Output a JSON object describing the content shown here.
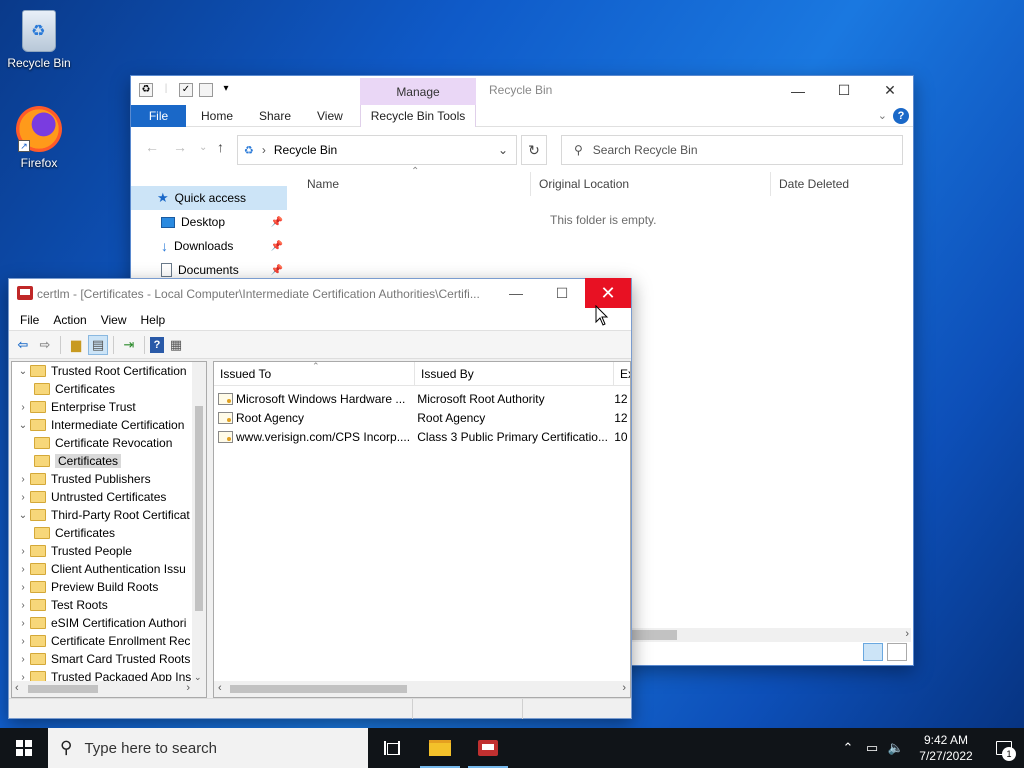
{
  "desktop": {
    "icons": [
      {
        "label": "Recycle Bin",
        "icon": "recycle-bin-icon"
      },
      {
        "label": "Firefox",
        "icon": "firefox-icon"
      }
    ]
  },
  "explorer": {
    "title": "Recycle Bin",
    "context_tab": "Manage",
    "ribbon_tabs": [
      "File",
      "Home",
      "Share",
      "View",
      "Recycle Bin Tools"
    ],
    "address": "Recycle Bin",
    "search_placeholder": "Search Recycle Bin",
    "nav": [
      {
        "label": "Quick access",
        "icon": "star-icon",
        "pinned": false
      },
      {
        "label": "Desktop",
        "icon": "desktop-icon",
        "pinned": true
      },
      {
        "label": "Downloads",
        "icon": "download-icon",
        "pinned": true
      },
      {
        "label": "Documents",
        "icon": "document-icon",
        "pinned": true
      }
    ],
    "columns": [
      "Name",
      "Original Location",
      "Date Deleted"
    ],
    "empty_message": "This folder is empty."
  },
  "certlm": {
    "title": "certlm - [Certificates - Local Computer\\Intermediate Certification Authorities\\Certifi...",
    "menu": [
      "File",
      "Action",
      "View",
      "Help"
    ],
    "tree": [
      {
        "label": "Trusted Root Certification",
        "level": 0,
        "expanded": true
      },
      {
        "label": "Certificates",
        "level": 1
      },
      {
        "label": "Enterprise Trust",
        "level": 0,
        "expanded": false
      },
      {
        "label": "Intermediate Certification",
        "level": 0,
        "expanded": true
      },
      {
        "label": "Certificate Revocation",
        "level": 1
      },
      {
        "label": "Certificates",
        "level": 1,
        "selected": true
      },
      {
        "label": "Trusted Publishers",
        "level": 0,
        "expanded": false
      },
      {
        "label": "Untrusted Certificates",
        "level": 0,
        "expanded": false
      },
      {
        "label": "Third-Party Root Certificat",
        "level": 0,
        "expanded": true
      },
      {
        "label": "Certificates",
        "level": 1
      },
      {
        "label": "Trusted People",
        "level": 0,
        "expanded": false
      },
      {
        "label": "Client Authentication Issu",
        "level": 0,
        "expanded": false
      },
      {
        "label": "Preview Build Roots",
        "level": 0,
        "expanded": false
      },
      {
        "label": "Test Roots",
        "level": 0,
        "expanded": false
      },
      {
        "label": "eSIM Certification Authori",
        "level": 0,
        "expanded": false
      },
      {
        "label": "Certificate Enrollment Rec",
        "level": 0,
        "expanded": false
      },
      {
        "label": "Smart Card Trusted Roots",
        "level": 0,
        "expanded": false
      },
      {
        "label": "Trusted Packaged App Ins",
        "level": 0,
        "expanded": false
      }
    ],
    "list_columns": [
      "Issued To",
      "Issued By",
      "Ex"
    ],
    "rows": [
      {
        "issued_to": "Microsoft Windows Hardware ...",
        "issued_by": "Microsoft Root Authority",
        "ex": "12"
      },
      {
        "issued_to": "Root Agency",
        "issued_by": "Root Agency",
        "ex": "12"
      },
      {
        "issued_to": "www.verisign.com/CPS Incorp....",
        "issued_by": "Class 3 Public Primary Certificatio...",
        "ex": "10"
      }
    ]
  },
  "taskbar": {
    "search_placeholder": "Type here to search",
    "time": "9:42 AM",
    "date": "7/27/2022",
    "notification_count": "1"
  }
}
